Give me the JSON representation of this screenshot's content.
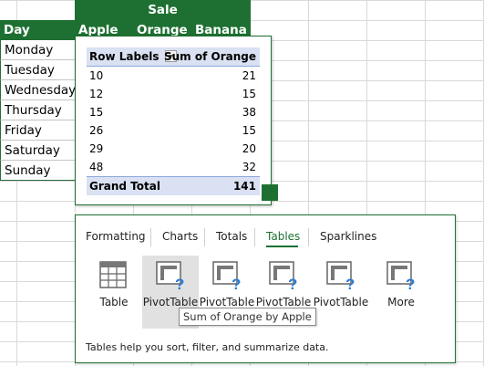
{
  "sheet": {
    "merged_header": "Sale",
    "columns": [
      "Day",
      "Apple",
      "Orange",
      "Banana"
    ],
    "days": [
      "Monday",
      "Tuesday",
      "Wednesday",
      "Thursday",
      "Friday",
      "Saturday",
      "Sunday"
    ]
  },
  "pivot_preview": {
    "col1_header": "Row Labels",
    "col2_header": "Sum of Orange",
    "rows": [
      {
        "label": "10",
        "value": "21"
      },
      {
        "label": "12",
        "value": "15"
      },
      {
        "label": "15",
        "value": "38"
      },
      {
        "label": "26",
        "value": "15"
      },
      {
        "label": "29",
        "value": "20"
      },
      {
        "label": "48",
        "value": "32"
      }
    ],
    "total_label": "Grand Total",
    "total_value": "141"
  },
  "quick_analysis": {
    "tabs": [
      "Formatting",
      "Charts",
      "Totals",
      "Tables",
      "Sparklines"
    ],
    "active_tab": "Tables",
    "buttons": [
      "Table",
      "PivotTable",
      "PivotTable",
      "PivotTable",
      "PivotTable",
      "More"
    ],
    "tooltip": "Sum of Orange by Apple",
    "description": "Tables help you sort, filter, and summarize data."
  },
  "colors": {
    "excel_green": "#1e7032",
    "pivot_header": "#d9e1f2",
    "tab_active": "#1e7032"
  }
}
